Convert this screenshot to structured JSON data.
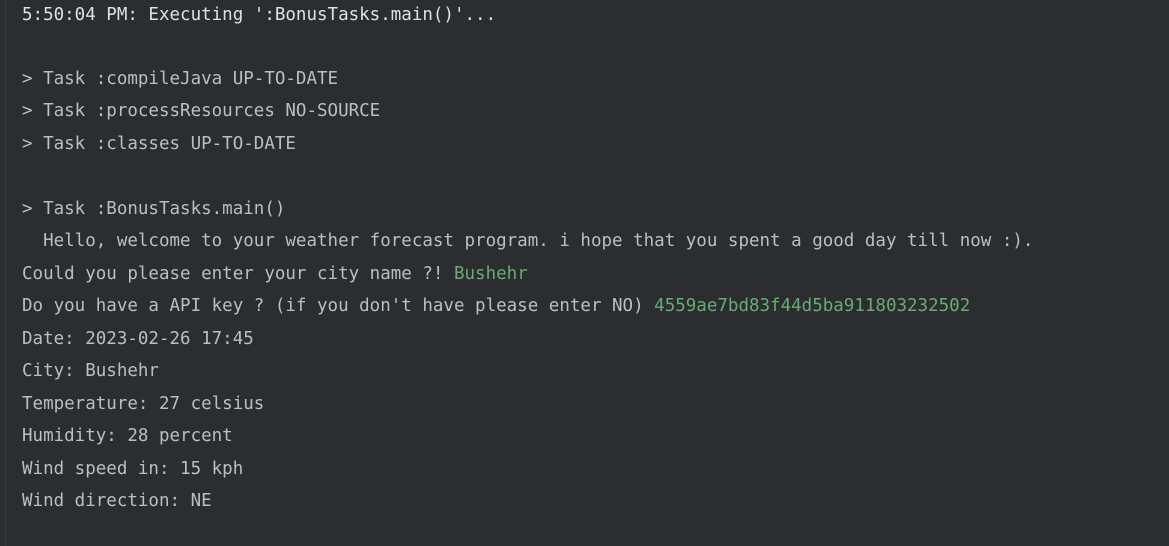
{
  "console": {
    "header": "5:50:04 PM: Executing ':BonusTasks.main()'...",
    "tasks": [
      "> Task :compileJava UP-TO-DATE",
      "> Task :processResources NO-SOURCE",
      "> Task :classes UP-TO-DATE"
    ],
    "main_task": "> Task :BonusTasks.main()",
    "welcome": "  Hello, welcome to your weather forecast program. i hope that you spent a good day till now :).",
    "city_prompt": "Could you please enter your city name ?! ",
    "city_input": "Bushehr",
    "api_prompt": "Do you have a API key ? (if you don't have please enter NO) ",
    "api_input": "4559ae7bd83f44d5ba911803232502",
    "results": [
      "Date: 2023-02-26 17:45",
      "City: Bushehr",
      "Temperature: 27 celsius",
      "Humidity: 28 percent",
      "Wind speed in: 15 kph",
      "Wind direction: NE"
    ]
  },
  "colors": {
    "background": "#2b2d30",
    "text": "#bcbec4",
    "user_input": "#6aab73"
  }
}
